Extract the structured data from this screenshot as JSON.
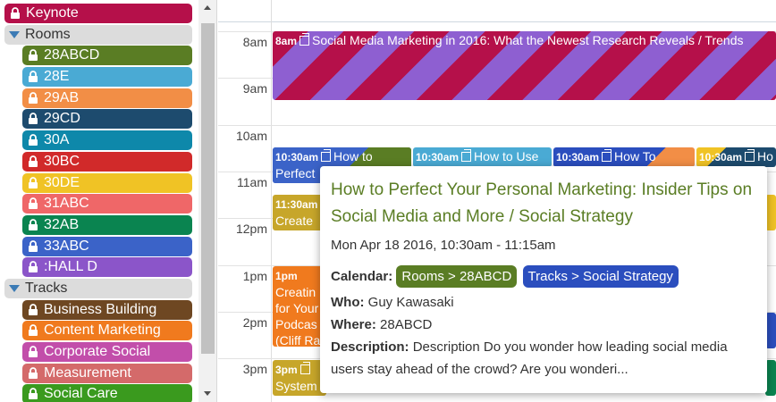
{
  "sidebar": {
    "keynote": {
      "label": "Keynote",
      "color": "#b5104a"
    },
    "rooms_group": {
      "label": "Rooms"
    },
    "rooms": [
      {
        "label": "28ABCD",
        "color": "#5a7d24"
      },
      {
        "label": "28E",
        "color": "#4aaad4"
      },
      {
        "label": "29AB",
        "color": "#f28e46"
      },
      {
        "label": "29CD",
        "color": "#1d4b6e"
      },
      {
        "label": "30A",
        "color": "#0e88aa"
      },
      {
        "label": "30BC",
        "color": "#d12a2a"
      },
      {
        "label": "30DE",
        "color": "#f0c325"
      },
      {
        "label": "31ABC",
        "color": "#ef6768"
      },
      {
        "label": "32AB",
        "color": "#0a8450"
      },
      {
        "label": "33ABC",
        "color": "#3b63c8"
      },
      {
        "label": ":HALL D",
        "color": "#8b55c9"
      }
    ],
    "tracks_group": {
      "label": "Tracks"
    },
    "tracks": [
      {
        "label": "Business Building",
        "color": "#6e4722"
      },
      {
        "label": "Content Marketing",
        "color": "#f07a1e"
      },
      {
        "label": "Corporate Social",
        "color": "#c24eaa"
      },
      {
        "label": "Measurement",
        "color": "#d46a6a"
      },
      {
        "label": "Social Care",
        "color": "#3a9a1e"
      }
    ]
  },
  "times": [
    "8am",
    "9am",
    "10am",
    "11am",
    "12pm",
    "1pm",
    "2pm",
    "3pm"
  ],
  "events": {
    "keynote": {
      "time": "8am",
      "title": "Social Media Marketing in 2016: What the Newest Research Reveals / Trends"
    },
    "e1": {
      "time": "10:30am",
      "title": "How to",
      "line2": "Perfect"
    },
    "e2": {
      "time": "10:30am",
      "title": "How to Use"
    },
    "e3": {
      "time": "10:30am",
      "title": "How To"
    },
    "e4": {
      "time": "10:30am",
      "title": "Ho"
    },
    "e5": {
      "time": "11:30am",
      "line2": "Create"
    },
    "e6": {
      "time": "1pm",
      "lines": [
        "Creatin",
        "for Your",
        "Podcas",
        "(Cliff Ra"
      ]
    },
    "e7": {
      "time": "3pm",
      "line2": "System"
    }
  },
  "popup": {
    "title": "How to Perfect Your Personal Marketing: Insider Tips on Social Media and More / Social Strategy",
    "date": "Mon Apr 18 2016, 10:30am - 11:15am",
    "calendar_label": "Calendar:",
    "calendar_badges": [
      {
        "label": "Rooms > 28ABCD",
        "color": "#5a7d24"
      },
      {
        "label": "Tracks > Social Strategy",
        "color": "#2b4ebe"
      }
    ],
    "who_label": "Who:",
    "who": "Guy Kawasaki",
    "where_label": "Where:",
    "where": "28ABCD",
    "description_label": "Description:",
    "description": "Description Do you wonder how leading social media users stay ahead of the crowd? Are you wonderi..."
  }
}
